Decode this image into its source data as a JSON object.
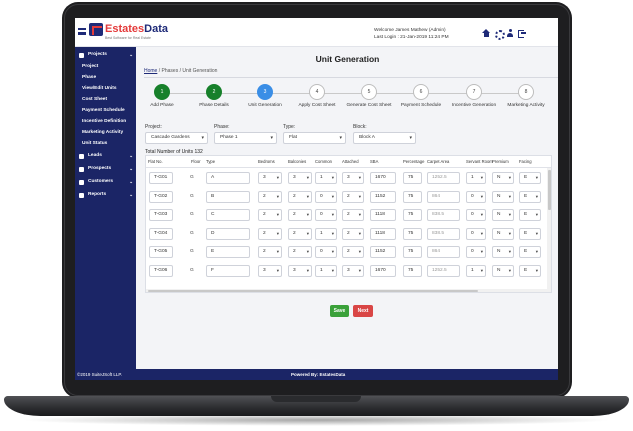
{
  "header": {
    "logo_part1": "Estates",
    "logo_part2": "Data",
    "logo_tagline": "Best Software for Real Estate",
    "welcome_line1": "Welcome James Mathew (Admin)",
    "welcome_line2": "Last Login     : 21-Jan-2019 11:24 PM",
    "icons": [
      "home-icon",
      "gear-icon",
      "user-icon",
      "logout-icon"
    ]
  },
  "sidebar": {
    "projects_label": "Projects",
    "sub_items": [
      "Project",
      "Phase",
      "View/Edit Units",
      "Cost Sheet",
      "Payment Schedule",
      "Incentive Definition",
      "Marketing Activity",
      "Unit Status"
    ],
    "main_items": [
      "Leads",
      "Prospects",
      "Customers",
      "Reports"
    ]
  },
  "footer": {
    "copyright": "©2019 SuiteJSoft LLP.",
    "powered": "Powered By: EstatesData"
  },
  "page": {
    "title": "Unit Generation",
    "breadcrumb": [
      "Home",
      "Phases",
      "Unit Generation"
    ]
  },
  "steps": [
    {
      "num": "1",
      "label": "Add Phase",
      "state": "done"
    },
    {
      "num": "2",
      "label": "Phase Details",
      "state": "done"
    },
    {
      "num": "3",
      "label": "Unit Generation",
      "state": "active"
    },
    {
      "num": "4",
      "label": "Apply Cost Sheet",
      "state": "todo"
    },
    {
      "num": "5",
      "label": "Generate Cost Sheet",
      "state": "todo"
    },
    {
      "num": "6",
      "label": "Payment Schedule",
      "state": "todo"
    },
    {
      "num": "7",
      "label": "Incentive Generation",
      "state": "todo"
    },
    {
      "num": "8",
      "label": "Marketing Activity",
      "state": "todo"
    }
  ],
  "filters": {
    "project_label": "Project:",
    "project_value": "Cascade Gardens",
    "phase_label": "Phase:",
    "phase_value": "Phase 1",
    "type_label": "Type:",
    "type_value": "Flat",
    "block_label": "Block:",
    "block_value": "Block A"
  },
  "table": {
    "total_label": "Total Number of Units 132",
    "headers": [
      "Flat No.",
      "Floor",
      "Type",
      "Bedroms",
      "Balconies",
      "Common",
      "Attached",
      "SBA",
      "Percentage",
      "Carpet Area",
      "Servant Room",
      "Premium",
      "Facing"
    ],
    "rows": [
      [
        "T-G01",
        "G",
        "A",
        "3",
        "3",
        "1",
        "3",
        "1670",
        "75",
        "1252.5",
        "1",
        "N",
        "E"
      ],
      [
        "T-G02",
        "G",
        "B",
        "2",
        "2",
        "0",
        "2",
        "1152",
        "75",
        "864",
        "0",
        "N",
        "E"
      ],
      [
        "T-G03",
        "G",
        "C",
        "2",
        "2",
        "0",
        "2",
        "1118",
        "75",
        "838.5",
        "0",
        "N",
        "E"
      ],
      [
        "T-G04",
        "G",
        "D",
        "2",
        "2",
        "1",
        "2",
        "1118",
        "75",
        "838.5",
        "0",
        "N",
        "E"
      ],
      [
        "T-G05",
        "G",
        "E",
        "2",
        "2",
        "0",
        "2",
        "1152",
        "75",
        "864",
        "0",
        "N",
        "E"
      ],
      [
        "T-G06",
        "G",
        "F",
        "3",
        "3",
        "1",
        "3",
        "1670",
        "75",
        "1252.5",
        "1",
        "N",
        "E"
      ]
    ]
  },
  "buttons": {
    "save": "Save",
    "next": "Next"
  },
  "colors": {
    "sidebar_bg": "#1b2566",
    "step_done": "#17802b",
    "step_active": "#3a8ee6",
    "save_btn": "#3aa13a",
    "next_btn": "#d94646"
  }
}
